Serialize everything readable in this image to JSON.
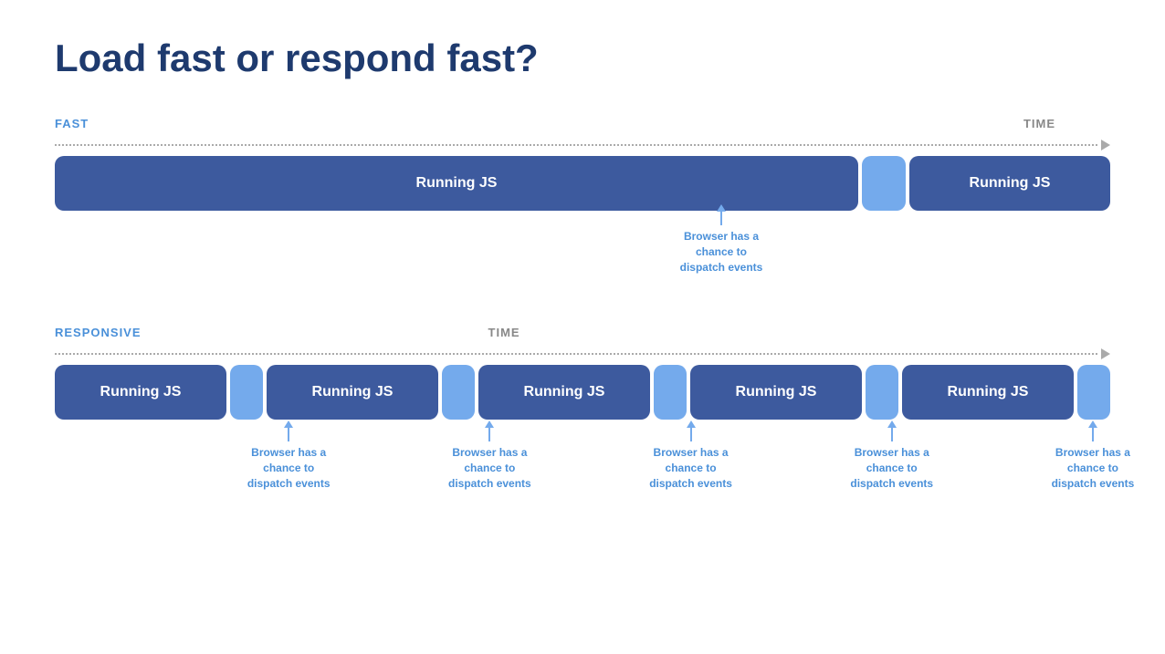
{
  "title": "Load fast or respond fast?",
  "fast_section": {
    "label": "FAST",
    "time_label": "TIME",
    "block1_label": "Running JS",
    "block2_label": "Running JS",
    "annotation": "Browser has a chance to dispatch events"
  },
  "responsive_section": {
    "label": "RESPONSIVE",
    "time_label": "TIME",
    "block_label": "Running JS",
    "annotation": "Browser has a chance to dispatch events",
    "num_blocks": 5
  }
}
